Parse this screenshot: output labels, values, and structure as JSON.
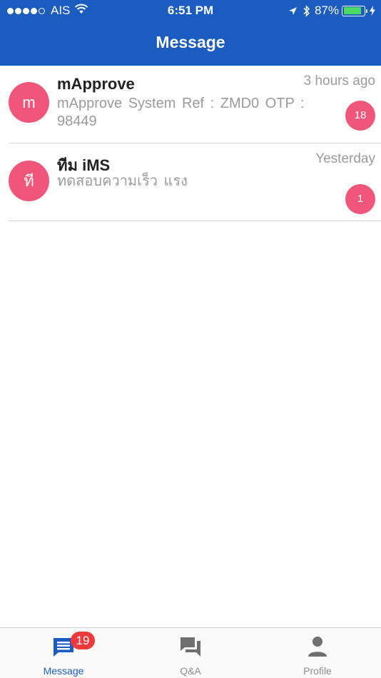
{
  "status_bar": {
    "carrier": "AIS",
    "time": "6:51 PM",
    "battery_percent": "87%",
    "battery_level": 0.87,
    "signal_bars": 4,
    "icons": [
      "signal-dots-icon",
      "wifi-icon",
      "location-arrow-icon",
      "bluetooth-icon",
      "battery-icon",
      "charging-bolt-icon"
    ]
  },
  "nav": {
    "title": "Message"
  },
  "messages": [
    {
      "avatar_letter": "m",
      "sender": "mApprove",
      "preview": "mApprove System   Ref : ZMD0   OTP : 98449",
      "time": "3 hours ago",
      "unread_count": "18"
    },
    {
      "avatar_letter": "ที",
      "sender": "ทีม iMS",
      "preview": "ทดสอบความเร็ว แรง",
      "time": "Yesterday",
      "unread_count": "1"
    }
  ],
  "tab_bar": {
    "tabs": [
      {
        "label": "Message",
        "icon": "message-list-icon",
        "badge": "19",
        "active": true
      },
      {
        "label": "Q&A",
        "icon": "chat-bubbles-icon",
        "active": false
      },
      {
        "label": "Profile",
        "icon": "person-icon",
        "active": false
      }
    ]
  },
  "colors": {
    "header": "#1a5cbf",
    "accent_pink": "#f0557a",
    "badge_red": "#f03a3a",
    "battery_green": "#4cd964"
  }
}
